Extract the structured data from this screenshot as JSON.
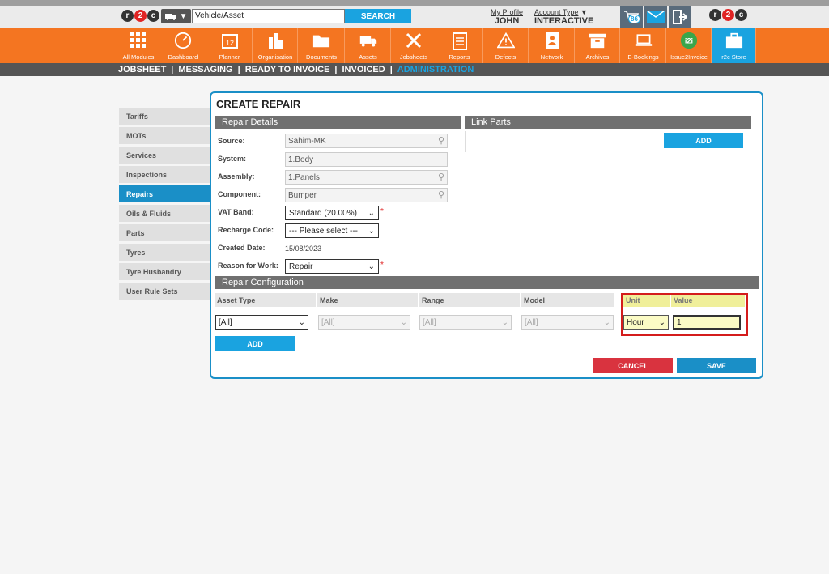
{
  "brand": {
    "logo_r": "r",
    "logo_2": "2",
    "logo_c": "c"
  },
  "header": {
    "vehicle_selector_icon": "truck-icon",
    "search_value": "Vehicle/Asset",
    "search_button": "SEARCH",
    "profile_link": "My Profile",
    "profile_name": "JOHN",
    "account_link": "Account Type",
    "account_name": "INTERACTIVE",
    "notification_count": "86"
  },
  "nav": [
    {
      "label": "All Modules",
      "icon": "grid-icon"
    },
    {
      "label": "Dashboard",
      "icon": "gauge-icon"
    },
    {
      "label": "Planner",
      "icon": "calendar-icon"
    },
    {
      "label": "Organisation",
      "icon": "building-icon"
    },
    {
      "label": "Documents",
      "icon": "folder-icon"
    },
    {
      "label": "Assets",
      "icon": "truck-icon"
    },
    {
      "label": "Jobsheets",
      "icon": "tools-icon"
    },
    {
      "label": "Reports",
      "icon": "clipboard-icon"
    },
    {
      "label": "Defects",
      "icon": "warning-icon"
    },
    {
      "label": "Network",
      "icon": "contact-book-icon"
    },
    {
      "label": "Archives",
      "icon": "archive-icon"
    },
    {
      "label": "E-Bookings",
      "icon": "laptop-icon"
    },
    {
      "label": "Issue2Invoice",
      "icon": "i2i-icon"
    },
    {
      "label": "r2c Store",
      "icon": "briefcase-icon"
    }
  ],
  "calendar_day": "12",
  "i2i_text": "i2i",
  "subnav": {
    "items": [
      "JOBSHEET",
      "MESSAGING",
      "READY TO INVOICE",
      "INVOICED",
      "ADMINISTRATION"
    ],
    "separator": "|"
  },
  "sidebar": {
    "items": [
      "Tariffs",
      "MOTs",
      "Services",
      "Inspections",
      "Repairs",
      "Oils & Fluids",
      "Parts",
      "Tyres",
      "Tyre Husbandry",
      "User Rule Sets"
    ],
    "active": "Repairs"
  },
  "form": {
    "title": "CREATE REPAIR",
    "repair_details_header": "Repair Details",
    "link_parts_header": "Link Parts",
    "link_parts_add": "ADD",
    "fields": {
      "source_label": "Source:",
      "source_value": "Sahim-MK",
      "system_label": "System:",
      "system_value": "1.Body",
      "assembly_label": "Assembly:",
      "assembly_value": "1.Panels",
      "component_label": "Component:",
      "component_value": "Bumper",
      "vat_label": "VAT Band:",
      "vat_value": "Standard (20.00%)",
      "recharge_label": "Recharge Code:",
      "recharge_value": "--- Please select ---",
      "created_label": "Created Date:",
      "created_value": "15/08/2023",
      "reason_label": "Reason for Work:",
      "reason_value": "Repair",
      "required_mark": "*"
    },
    "config_header": "Repair Configuration",
    "columns": [
      "Asset Type",
      "Make",
      "Range",
      "Model",
      "Unit",
      "Value"
    ],
    "row": {
      "asset_type": "[All]",
      "make": "[All]",
      "range": "[All]",
      "model": "[All]",
      "unit": "Hour",
      "value": "1"
    },
    "config_add": "ADD",
    "cancel": "CANCEL",
    "save": "SAVE"
  },
  "colors": {
    "orange": "#f47521",
    "blue": "#1aa3e0",
    "red": "#d9333f",
    "highlight": "#d41c1c"
  }
}
